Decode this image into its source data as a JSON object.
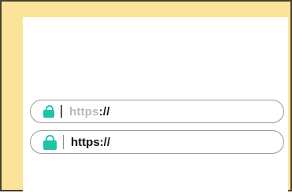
{
  "urlbar_1": {
    "protocol": "https",
    "separator": "://"
  },
  "urlbar_2": {
    "text": "https://"
  },
  "colors": {
    "background": "#fbe39b",
    "card": "#ffffff",
    "lock_accent": "#1fc3a7",
    "faded_protocol": "#b8b8b8",
    "text": "#111111"
  },
  "icons": [
    "lock-icon",
    "lock-icon"
  ]
}
